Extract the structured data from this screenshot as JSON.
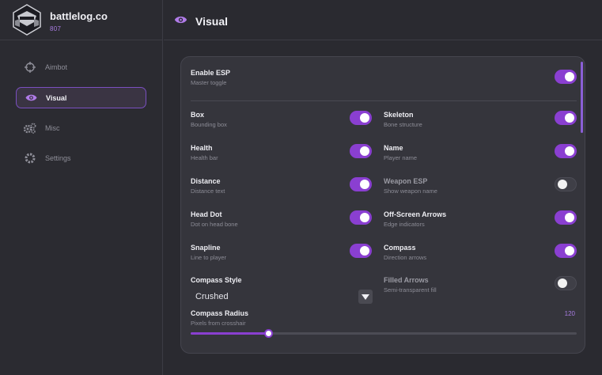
{
  "brand": {
    "name": "battlelog.co",
    "sub": "807"
  },
  "nav": {
    "items": [
      {
        "label": "Aimbot",
        "icon": "crosshair-icon",
        "active": false
      },
      {
        "label": "Visual",
        "icon": "eye-icon",
        "active": true
      },
      {
        "label": "Misc",
        "icon": "gears-icon",
        "active": false
      },
      {
        "label": "Settings",
        "icon": "gear-icon",
        "active": false
      }
    ]
  },
  "header": {
    "title": "Visual",
    "icon": "eye-icon"
  },
  "colors": {
    "accent": "#8a3fd1",
    "accent_text": "#a77be0",
    "bg": "#2a2a30",
    "card": "#35353c"
  },
  "master": {
    "title": "Enable ESP",
    "desc": "Master toggle",
    "on": true
  },
  "options": {
    "box": {
      "title": "Box",
      "desc": "Bounding box",
      "on": true
    },
    "skeleton": {
      "title": "Skeleton",
      "desc": "Bone structure",
      "on": true
    },
    "health": {
      "title": "Health",
      "desc": "Health bar",
      "on": true
    },
    "name": {
      "title": "Name",
      "desc": "Player name",
      "on": true
    },
    "distance": {
      "title": "Distance",
      "desc": "Distance text",
      "on": true
    },
    "weapon_esp": {
      "title": "Weapon ESP",
      "desc": "Show weapon name",
      "on": false
    },
    "head_dot": {
      "title": "Head Dot",
      "desc": "Dot on head bone",
      "on": true
    },
    "offscreen_arrows": {
      "title": "Off-Screen Arrows",
      "desc": "Edge indicators",
      "on": true
    },
    "snapline": {
      "title": "Snapline",
      "desc": "Line to player",
      "on": true
    },
    "compass": {
      "title": "Compass",
      "desc": "Direction arrows",
      "on": true
    },
    "filled_arrows": {
      "title": "Filled Arrows",
      "desc": "Semi-transparent fill",
      "on": false
    }
  },
  "compass_style": {
    "title": "Compass Style",
    "value": "Crushed"
  },
  "compass_radius": {
    "title": "Compass Radius",
    "desc": "Pixels from crosshair",
    "value": "120",
    "fraction": 0.2
  }
}
